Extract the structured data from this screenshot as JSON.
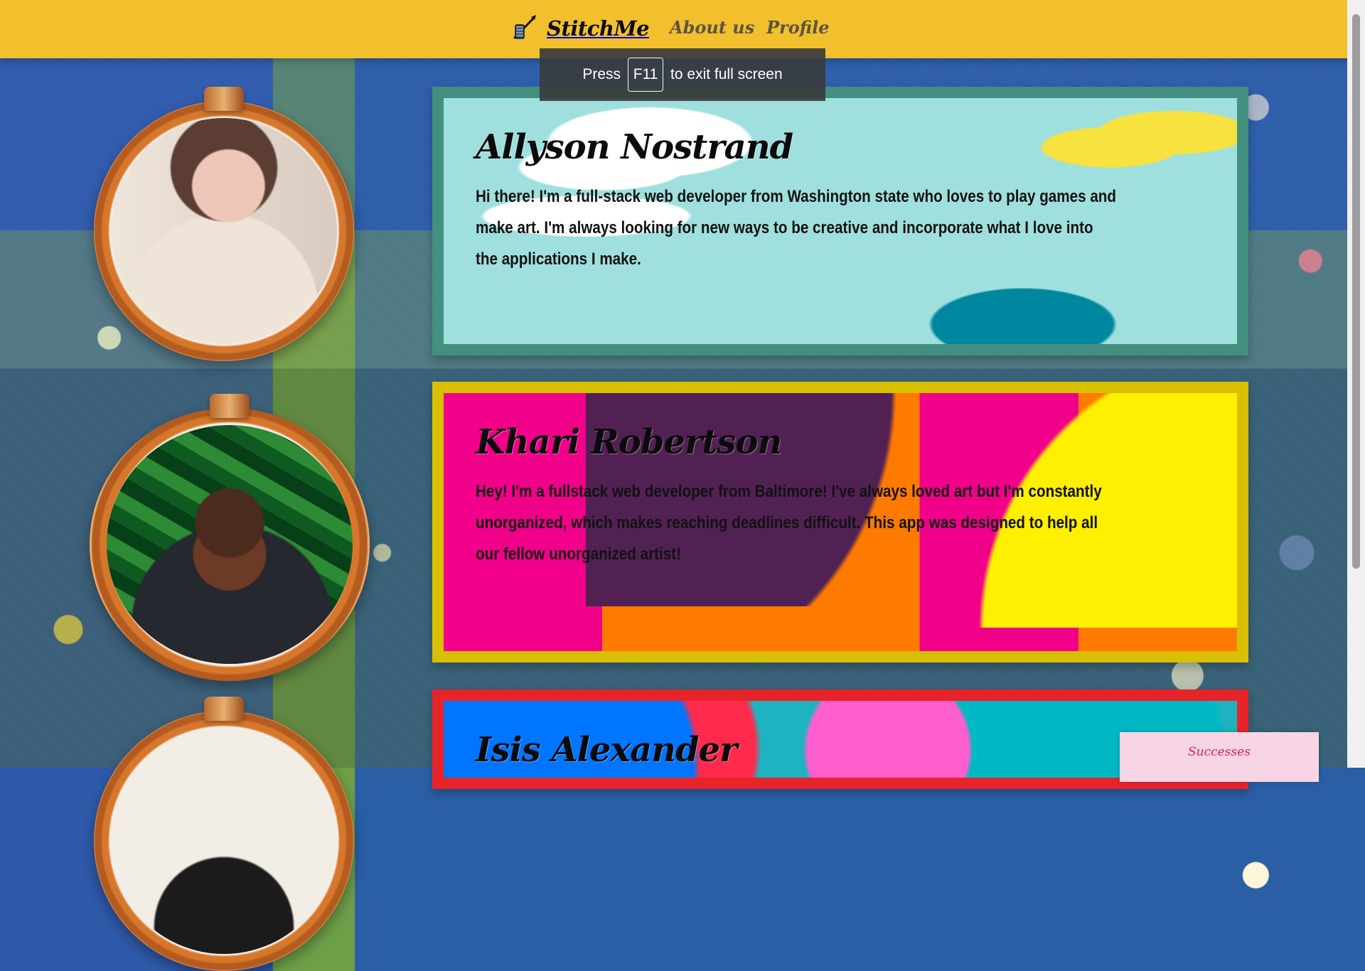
{
  "app": {
    "brand": "StitchMe",
    "nav": [
      {
        "label": "About us"
      },
      {
        "label": "Profile"
      }
    ]
  },
  "overlay": {
    "press": "Press",
    "key": "F11",
    "message": "to exit full screen"
  },
  "people": [
    {
      "name": "Allyson Nostrand",
      "bio": "Hi there! I'm a full-stack web developer from Washington state who loves to play games and make art. I'm always looking for new ways to be creative and incorporate what I love into the applications I make."
    },
    {
      "name": "Khari Robertson",
      "bio": "Hey! I'm a fullstack web developer from Baltimore! I've always loved art but I'm constantly unorganized, which makes reaching deadlines difficult. This app was designed to help all our fellow unorganized artist!"
    },
    {
      "name": "Isis Alexander",
      "bio": ""
    }
  ],
  "floating_tab": {
    "label": "Successes"
  },
  "colors": {
    "header": "#f2c02c",
    "card_1_border": "#438f80",
    "card_2_border": "#d8bf00",
    "card_3_border": "#e7242a",
    "overlay": "#393c3e"
  },
  "icons": {
    "brand": "sewing-needle-icon"
  }
}
